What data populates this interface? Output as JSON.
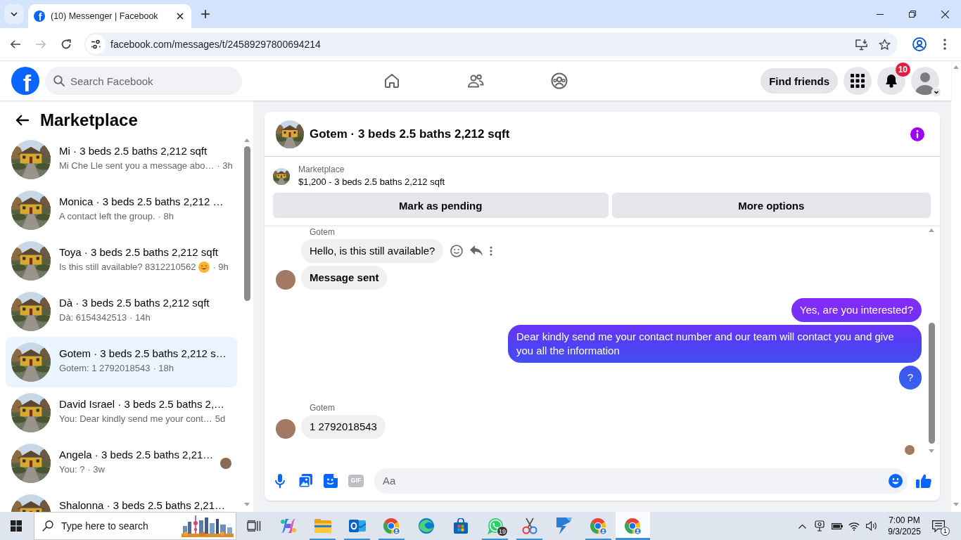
{
  "browser": {
    "favicon": "f",
    "tab_title": "(10) Messenger | Facebook",
    "url": "facebook.com/messages/t/24589297800694214",
    "can_go_forward": false
  },
  "header": {
    "logo": "f",
    "search": {
      "placeholder": "Search Facebook"
    },
    "find_friends": "Find friends",
    "notification_count": "10"
  },
  "sidebar": {
    "title": "Marketplace",
    "conversations": [
      {
        "title": "Mi · 3 beds 2.5 baths 2,212 sqft",
        "preview": "Mi Che Lle sent you a message abo…",
        "time": "· 3h",
        "emoji": false,
        "selected": false,
        "seen": false
      },
      {
        "title": "Monica · 3 beds 2.5 baths 2,212 …",
        "preview": "A contact left the group.",
        "time": "· 8h",
        "emoji": false,
        "selected": false,
        "seen": false
      },
      {
        "title": "Toya · 3 beds 2.5 baths 2,212 sqft",
        "preview": "Is this still available? 8312210562",
        "time": "· 9h",
        "emoji": true,
        "selected": false,
        "seen": false
      },
      {
        "title": "Dà · 3 beds 2.5 baths 2,212 sqft",
        "preview": "Dà: 6154342513",
        "time": "· 14h",
        "emoji": false,
        "selected": false,
        "seen": false
      },
      {
        "title": "Gotem · 3 beds 2.5 baths 2,212 s…",
        "preview": "Gotem: 1 2792018543",
        "time": "· 18h",
        "emoji": false,
        "selected": true,
        "seen": false
      },
      {
        "title": "David Israel · 3 beds 2.5 baths 2,…",
        "preview": "You: Dear kindly send me your cont…",
        "time": "5d",
        "emoji": false,
        "selected": false,
        "seen": false
      },
      {
        "title": "Angela · 3 beds 2.5 baths 2,21…",
        "preview": "You: ?",
        "time": "· 3w",
        "emoji": false,
        "selected": false,
        "seen": true
      },
      {
        "title": "Shalonna · 3 beds 2.5 baths 2,21…",
        "emoji": false,
        "selected": false,
        "seen": false
      }
    ]
  },
  "chat": {
    "title": "Gotem · 3 beds 2.5 baths 2,212 sqft",
    "listing": {
      "source": "Marketplace",
      "summary": "$1,200 - 3 beds 2.5 baths 2,212 sqft"
    },
    "actions": [
      "Mark as pending",
      "More options"
    ],
    "messages": [
      {
        "kind": "incoming",
        "sender": "Gotem",
        "text": "Hello, is this still available?",
        "bold": false,
        "avatar": false,
        "hovered": true
      },
      {
        "kind": "incoming",
        "text": "Message sent",
        "bold": true,
        "avatar": true,
        "hovered": false
      },
      {
        "kind": "outgoing",
        "text": "Yes, are you interested?",
        "bold": false
      },
      {
        "kind": "outgoing",
        "text": "Dear kindly send me your contact number and our team will contact you and give you all the information",
        "bold": false
      },
      {
        "kind": "outgoing",
        "text": "?",
        "bold": false
      },
      {
        "kind": "incoming",
        "sender": "Gotem",
        "text": "1 2792018543",
        "bold": false,
        "avatar": true,
        "hovered": false
      }
    ],
    "read_receipt": true,
    "composer": {
      "gif": "GIF",
      "placeholder": "Aa"
    }
  },
  "taskbar": {
    "search": {
      "placeholder": "Type here to search"
    },
    "apps": [
      {
        "kind": "copilot",
        "running": false,
        "selected": false
      },
      {
        "kind": "files",
        "running": true,
        "selected": false
      },
      {
        "kind": "mail",
        "running": true,
        "selected": false
      },
      {
        "kind": "chrome",
        "running": true,
        "selected": false
      },
      {
        "kind": "edge",
        "running": false,
        "selected": false
      },
      {
        "kind": "store",
        "running": false,
        "selected": false
      },
      {
        "kind": "whatsapp",
        "running": true,
        "selected": false,
        "badge": "19"
      },
      {
        "kind": "snipping",
        "running": true,
        "selected": false
      },
      {
        "kind": "automate",
        "running": false,
        "selected": false
      },
      {
        "kind": "chrome",
        "running": true,
        "selected": false
      },
      {
        "kind": "chrome",
        "running": true,
        "selected": true
      }
    ],
    "time": "7:00 PM",
    "date": "9/3/2025",
    "notification_count": "1"
  }
}
